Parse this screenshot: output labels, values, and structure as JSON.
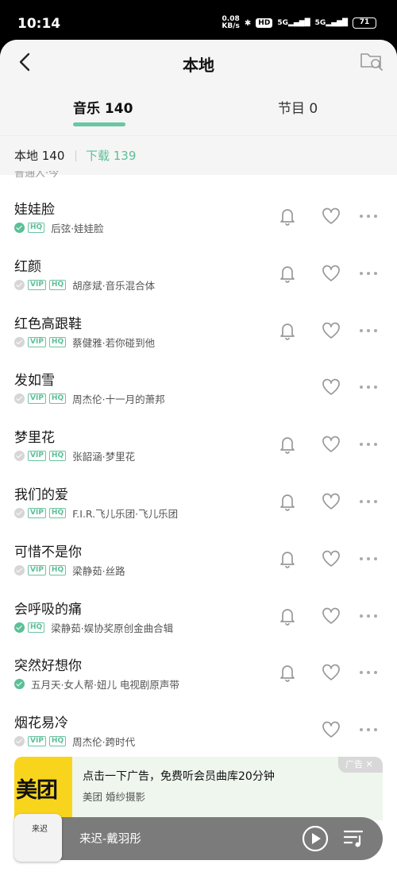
{
  "status_bar": {
    "time": "10:14",
    "net_speed_value": "0.08",
    "net_speed_unit": "KB/s",
    "hd_label": "HD",
    "sim1": "5G",
    "sim2": "5G",
    "battery": "71"
  },
  "header": {
    "title": "本地",
    "back_icon": "chevron-left-icon",
    "search_icon": "folder-search-icon"
  },
  "tabs": [
    {
      "label": "音乐 140",
      "active": true
    },
    {
      "label": "节目 0",
      "active": false
    }
  ],
  "filter": {
    "local": "本地 140",
    "download": "下载 139"
  },
  "partial_row_text": "普通人·今",
  "songs": [
    {
      "title": "娃娃脸",
      "checked": true,
      "vip": false,
      "hq": true,
      "meta": "后弦·娃娃脸",
      "bell": true
    },
    {
      "title": "红颜",
      "checked": false,
      "vip": true,
      "hq": true,
      "meta": "胡彦斌·音乐混合体",
      "bell": true
    },
    {
      "title": "红色高跟鞋",
      "checked": false,
      "vip": true,
      "hq": true,
      "meta": "蔡健雅·若你碰到他",
      "bell": true
    },
    {
      "title": "发如雪",
      "checked": false,
      "vip": true,
      "hq": true,
      "meta": "周杰伦·十一月的萧邦",
      "bell": false
    },
    {
      "title": "梦里花",
      "checked": false,
      "vip": true,
      "hq": true,
      "meta": "张韶涵·梦里花",
      "bell": true
    },
    {
      "title": "我们的爱",
      "checked": false,
      "vip": true,
      "hq": true,
      "meta": "F.I.R.飞儿乐团·飞儿乐团",
      "bell": true
    },
    {
      "title": "可惜不是你",
      "checked": false,
      "vip": true,
      "hq": true,
      "meta": "梁静茹·丝路",
      "bell": true
    },
    {
      "title": "会呼吸的痛",
      "checked": true,
      "vip": false,
      "hq": true,
      "meta": "梁静茹·娱协奖原创金曲合辑",
      "bell": true
    },
    {
      "title": "突然好想你",
      "checked": true,
      "vip": false,
      "hq": false,
      "meta": "五月天·女人帮·妞儿 电视剧原声带",
      "bell": true
    },
    {
      "title": "烟花易冷",
      "checked": false,
      "vip": true,
      "hq": true,
      "meta": "周杰伦·跨时代",
      "bell": false
    }
  ],
  "badges": {
    "vip": "VIP",
    "hq": "HQ"
  },
  "ad": {
    "logo_text": "美团",
    "title": "点击一下广告，免费听会员曲库20分钟",
    "subtitle": "美团 婚纱摄影",
    "badge": "广告 ✕"
  },
  "player": {
    "album_text": "来迟",
    "now_playing": "来迟-戴羽彤"
  },
  "colors": {
    "accent": "#5cbf97",
    "player_bg": "#7b7b7b",
    "ad_bg": "#eef6ee",
    "logo_yellow": "#f8d51c"
  }
}
